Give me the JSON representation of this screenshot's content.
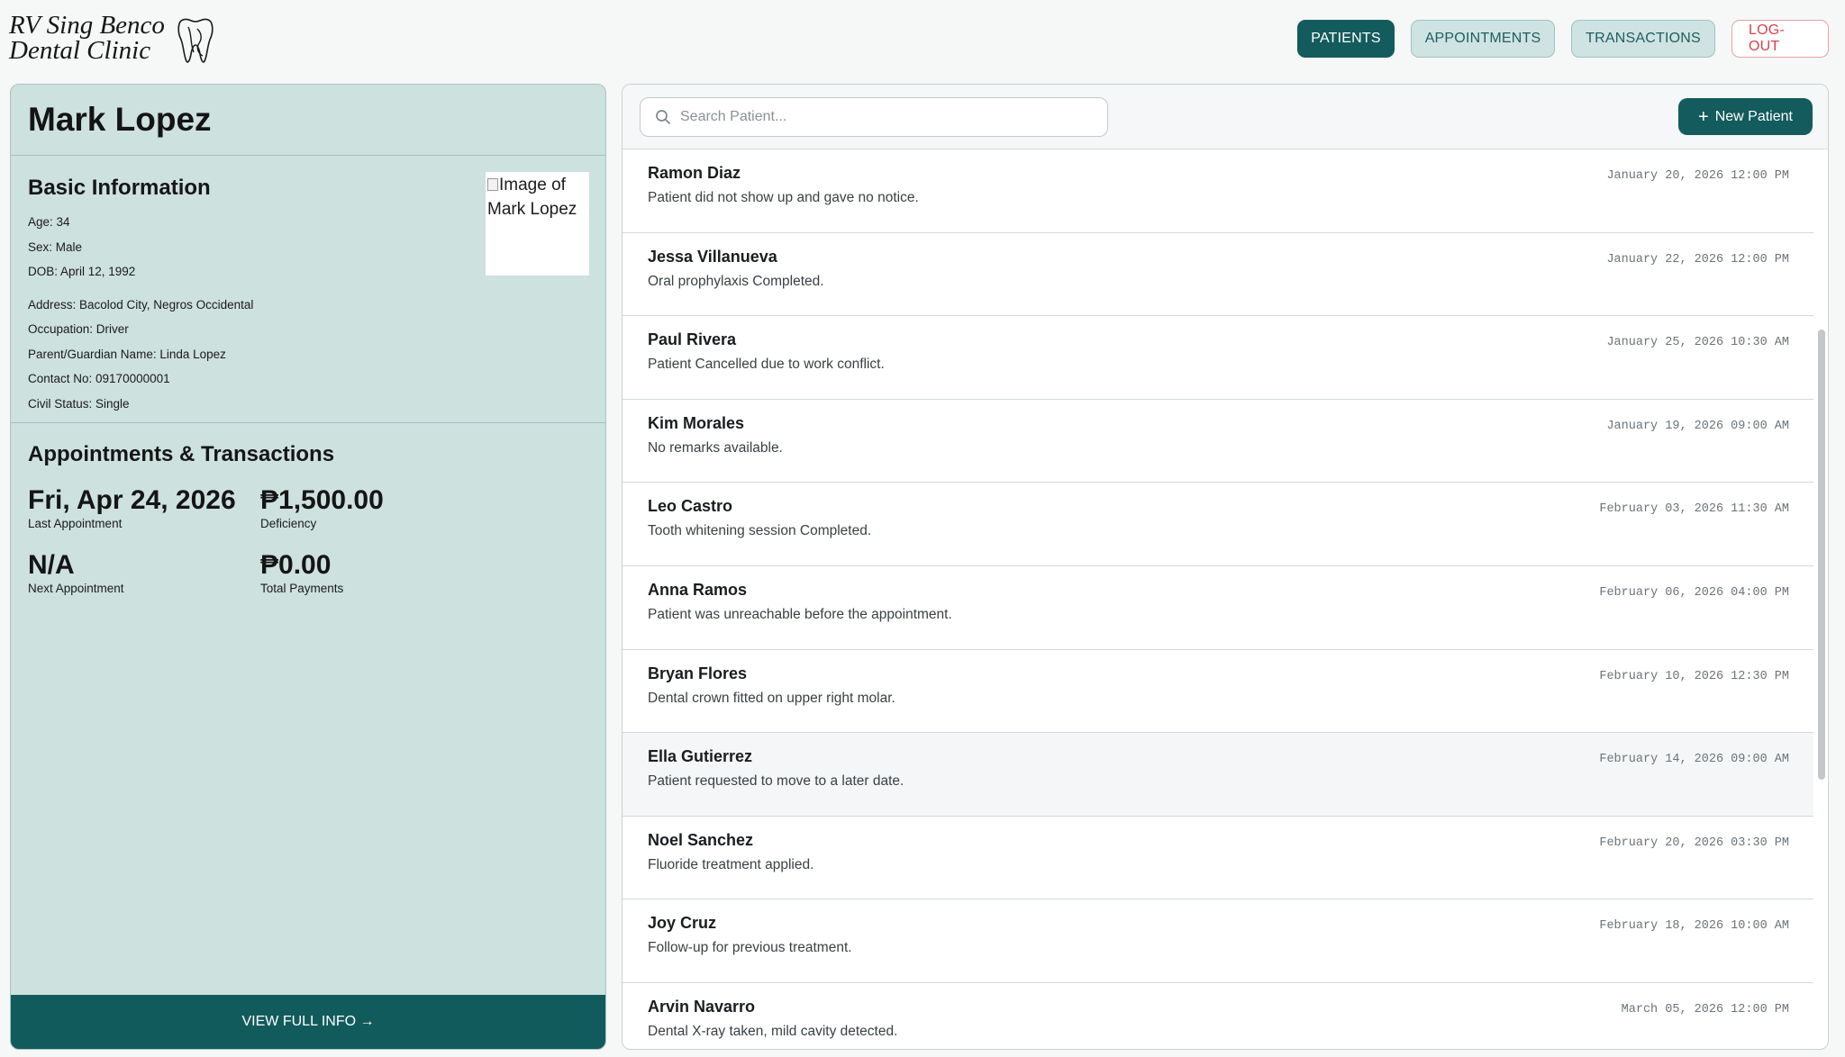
{
  "brand": {
    "line1": "RV Sing Benco",
    "line2": "Dental Clinic",
    "icon": "tooth-logo-icon"
  },
  "nav": {
    "patients": "PATIENTS",
    "appointments": "APPOINTMENTS",
    "transactions": "TRANSACTIONS",
    "logout": "LOG-OUT"
  },
  "patient": {
    "name": "Mark Lopez",
    "basic_title": "Basic Information",
    "photo_alt": "Image of Mark Lopez",
    "age": "Age: 34",
    "sex": "Sex: Male",
    "dob": "DOB: April 12, 1992",
    "address": "Address: Bacolod City, Negros Occidental",
    "occupation": "Occupation: Driver",
    "guardian": "Parent/Guardian Name: Linda Lopez",
    "contact": "Contact No: 09170000001",
    "civil_status": "Civil Status: Single",
    "appt_title": "Appointments & Transactions",
    "last_appointment": "Fri, Apr 24, 2026",
    "last_appointment_label": "Last Appointment",
    "deficiency": "₱1,500.00",
    "deficiency_label": "Deficiency",
    "next_appointment": "N/A",
    "next_appointment_label": "Next Appointment",
    "total_payments": "₱0.00",
    "total_payments_label": "Total Payments",
    "view_full": "VIEW FULL INFO →"
  },
  "toolbar": {
    "search_placeholder": "Search Patient...",
    "new_patient": "New Patient"
  },
  "rows": [
    {
      "name": "Ramon Diaz",
      "remark": "Patient did not show up and gave no notice.",
      "date": "January 20, 2026 12:00 PM"
    },
    {
      "name": "Jessa Villanueva",
      "remark": "Oral prophylaxis Completed.",
      "date": "January 22, 2026 12:00 PM"
    },
    {
      "name": "Paul Rivera",
      "remark": "Patient Cancelled due to work conflict.",
      "date": "January 25, 2026 10:30 AM"
    },
    {
      "name": "Kim Morales",
      "remark": "No remarks available.",
      "date": "January 19, 2026 09:00 AM"
    },
    {
      "name": "Leo Castro",
      "remark": "Tooth whitening session Completed.",
      "date": "February 03, 2026 11:30 AM"
    },
    {
      "name": "Anna Ramos",
      "remark": "Patient was unreachable before the appointment.",
      "date": "February 06, 2026 04:00 PM"
    },
    {
      "name": "Bryan Flores",
      "remark": "Dental crown fitted on upper right molar.",
      "date": "February 10, 2026 12:30 PM"
    },
    {
      "name": "Ella Gutierrez",
      "remark": "Patient requested to move to a later date.",
      "date": "February 14, 2026 09:00 AM"
    },
    {
      "name": "Noel Sanchez",
      "remark": "Fluoride treatment applied.",
      "date": "February 20, 2026 03:30 PM"
    },
    {
      "name": "Joy Cruz",
      "remark": "Follow-up for previous treatment.",
      "date": "February 18, 2026 10:00 AM"
    },
    {
      "name": "Arvin Navarro",
      "remark": "Dental X-ray taken, mild cavity detected.",
      "date": "March 05, 2026 12:00 PM"
    }
  ]
}
